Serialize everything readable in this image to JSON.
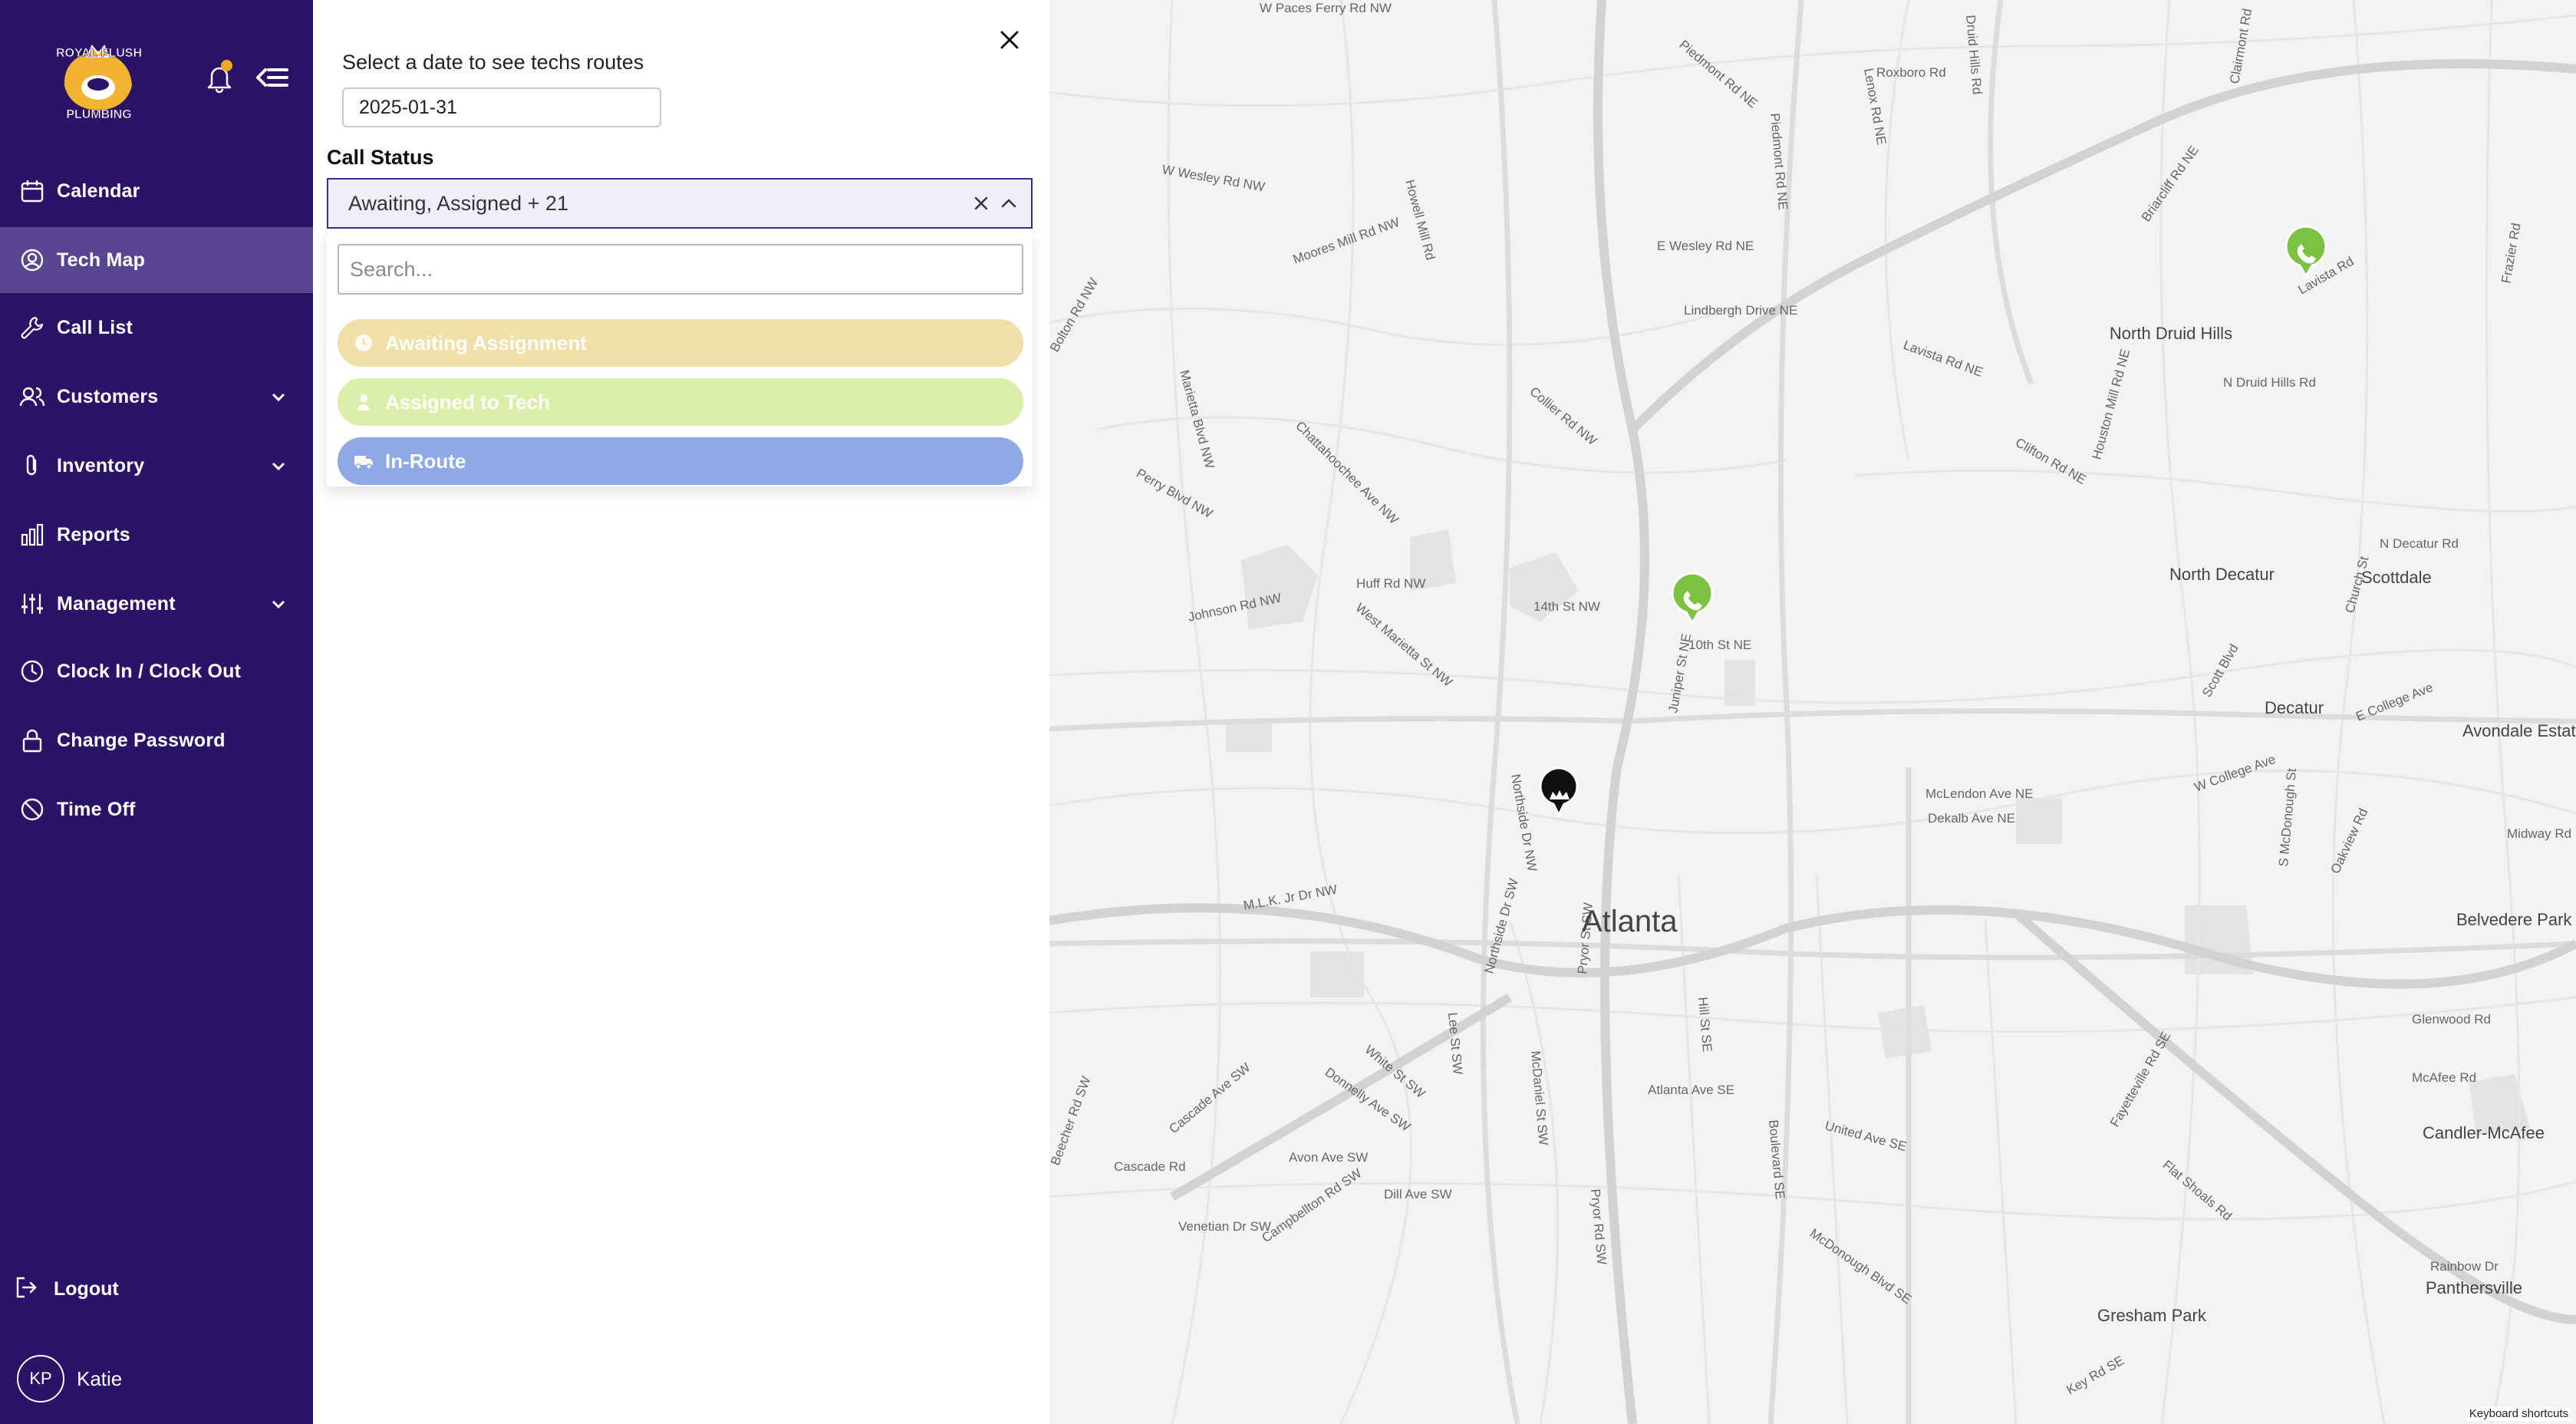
{
  "brand": {
    "line1": "ROYAL FLUSH",
    "line2": "PLUMBING",
    "colors": {
      "sidebar": "#2b1368",
      "active": "#5a4690",
      "accent": "#f2a81d"
    }
  },
  "header": {
    "notification_icon": "bell-icon",
    "collapse_icon": "collapse-menu-icon"
  },
  "sidebar": {
    "items": [
      {
        "label": "Calendar",
        "icon": "calendar-icon"
      },
      {
        "label": "Tech Map",
        "icon": "user-circle-icon",
        "active": true
      },
      {
        "label": "Call List",
        "icon": "wrench-icon"
      },
      {
        "label": "Customers",
        "icon": "users-icon",
        "expandable": true
      },
      {
        "label": "Inventory",
        "icon": "paperclip-icon",
        "expandable": true
      },
      {
        "label": "Reports",
        "icon": "bar-chart-icon"
      },
      {
        "label": "Management",
        "icon": "sliders-icon",
        "expandable": true
      },
      {
        "label": "Clock In / Clock Out",
        "icon": "clock-icon"
      },
      {
        "label": "Change Password",
        "icon": "lock-icon"
      },
      {
        "label": "Time Off",
        "icon": "ban-icon"
      }
    ],
    "logout": "Logout",
    "user": {
      "initials": "KP",
      "name": "Katie"
    }
  },
  "panel": {
    "date_prompt": "Select a date to see techs routes",
    "date_value": "2025-01-31",
    "call_status_label": "Call Status",
    "selected_summary": "Awaiting, Assigned + 21",
    "search_placeholder": "Search...",
    "options": [
      {
        "label": "Awaiting Assignment",
        "icon": "clock-icon",
        "color": "#f0dfa6"
      },
      {
        "label": "Assigned to Tech",
        "icon": "person-icon",
        "color": "#dcefaa"
      },
      {
        "label": "In-Route",
        "icon": "truck-icon",
        "color": "#8fa9e6"
      }
    ]
  },
  "map": {
    "city": "Atlanta",
    "places": [
      "North Druid Hills",
      "North Decatur",
      "Scottdale",
      "Decatur",
      "Avondale Estates",
      "Belvedere Park",
      "Candler-McAfee",
      "Panthersville",
      "Gresham Park"
    ],
    "streets": [
      "W Paces Ferry Rd NW",
      "Piedmont Rd NE",
      "Roxboro Rd",
      "Lenox Rd NE",
      "Druid Hills Rd",
      "Briarcliff Rd NE",
      "W Wesley Rd NW",
      "Moores Mill Rd NW",
      "Howell Mill Rd",
      "Piedmont Rd NE",
      "E Wesley Rd NE",
      "Lindbergh Drive NE",
      "Lavista Rd NE",
      "N Druid Hills Rd",
      "Bolton Rd NW",
      "Marietta Blvd NW",
      "Chattahoochee Ave NW",
      "Collier Rd NW",
      "Houston Mill Rd NE",
      "Clifton Rd NE",
      "Perry Blvd NW",
      "Huff Rd NW",
      "14th St NW",
      "10th St NE",
      "Juniper St NE",
      "West Marietta St NW",
      "Johnson Rd NW",
      "Scott Blvd",
      "E College Ave",
      "McLendon Ave NE",
      "Dekalb Ave NE",
      "W College Ave",
      "Northside Dr NW",
      "M.L.K. Jr Dr NW",
      "Northside Dr SW",
      "Pryor St SW",
      "Hill St SE",
      "Lee St SW",
      "McDaniel St SW",
      "White St SW",
      "Donnelly Ave SW",
      "Beecher Rd SW",
      "Cascade Ave SW",
      "Atlanta Ave SE",
      "Boulevard SE",
      "United Ave SE",
      "Avon Ave SW",
      "Cascade Rd",
      "Dill Ave SW",
      "Campbellton Rd SW",
      "Venetian Dr SW",
      "Pryor Rd SW",
      "McDonough Blvd SE",
      "Fayetteville Rd SE",
      "Flat Shoals Rd",
      "Glenwood Rd",
      "McAfee Rd",
      "Rainbow Dr",
      "Midway Rd",
      "Key Rd SE",
      "N Decatur Rd",
      "Church St",
      "Clairmont Rd",
      "Frazier Rd",
      "Lavista Rd",
      "Oakview Rd",
      "S McDonough St"
    ],
    "keyboard_shortcuts": "Keyboard shortcuts",
    "markers": [
      {
        "type": "call",
        "icon": "phone-icon",
        "color": "#7cc242"
      },
      {
        "type": "call",
        "icon": "phone-icon",
        "color": "#7cc242"
      },
      {
        "type": "office",
        "icon": "crown-icon",
        "color": "#111111"
      }
    ]
  }
}
